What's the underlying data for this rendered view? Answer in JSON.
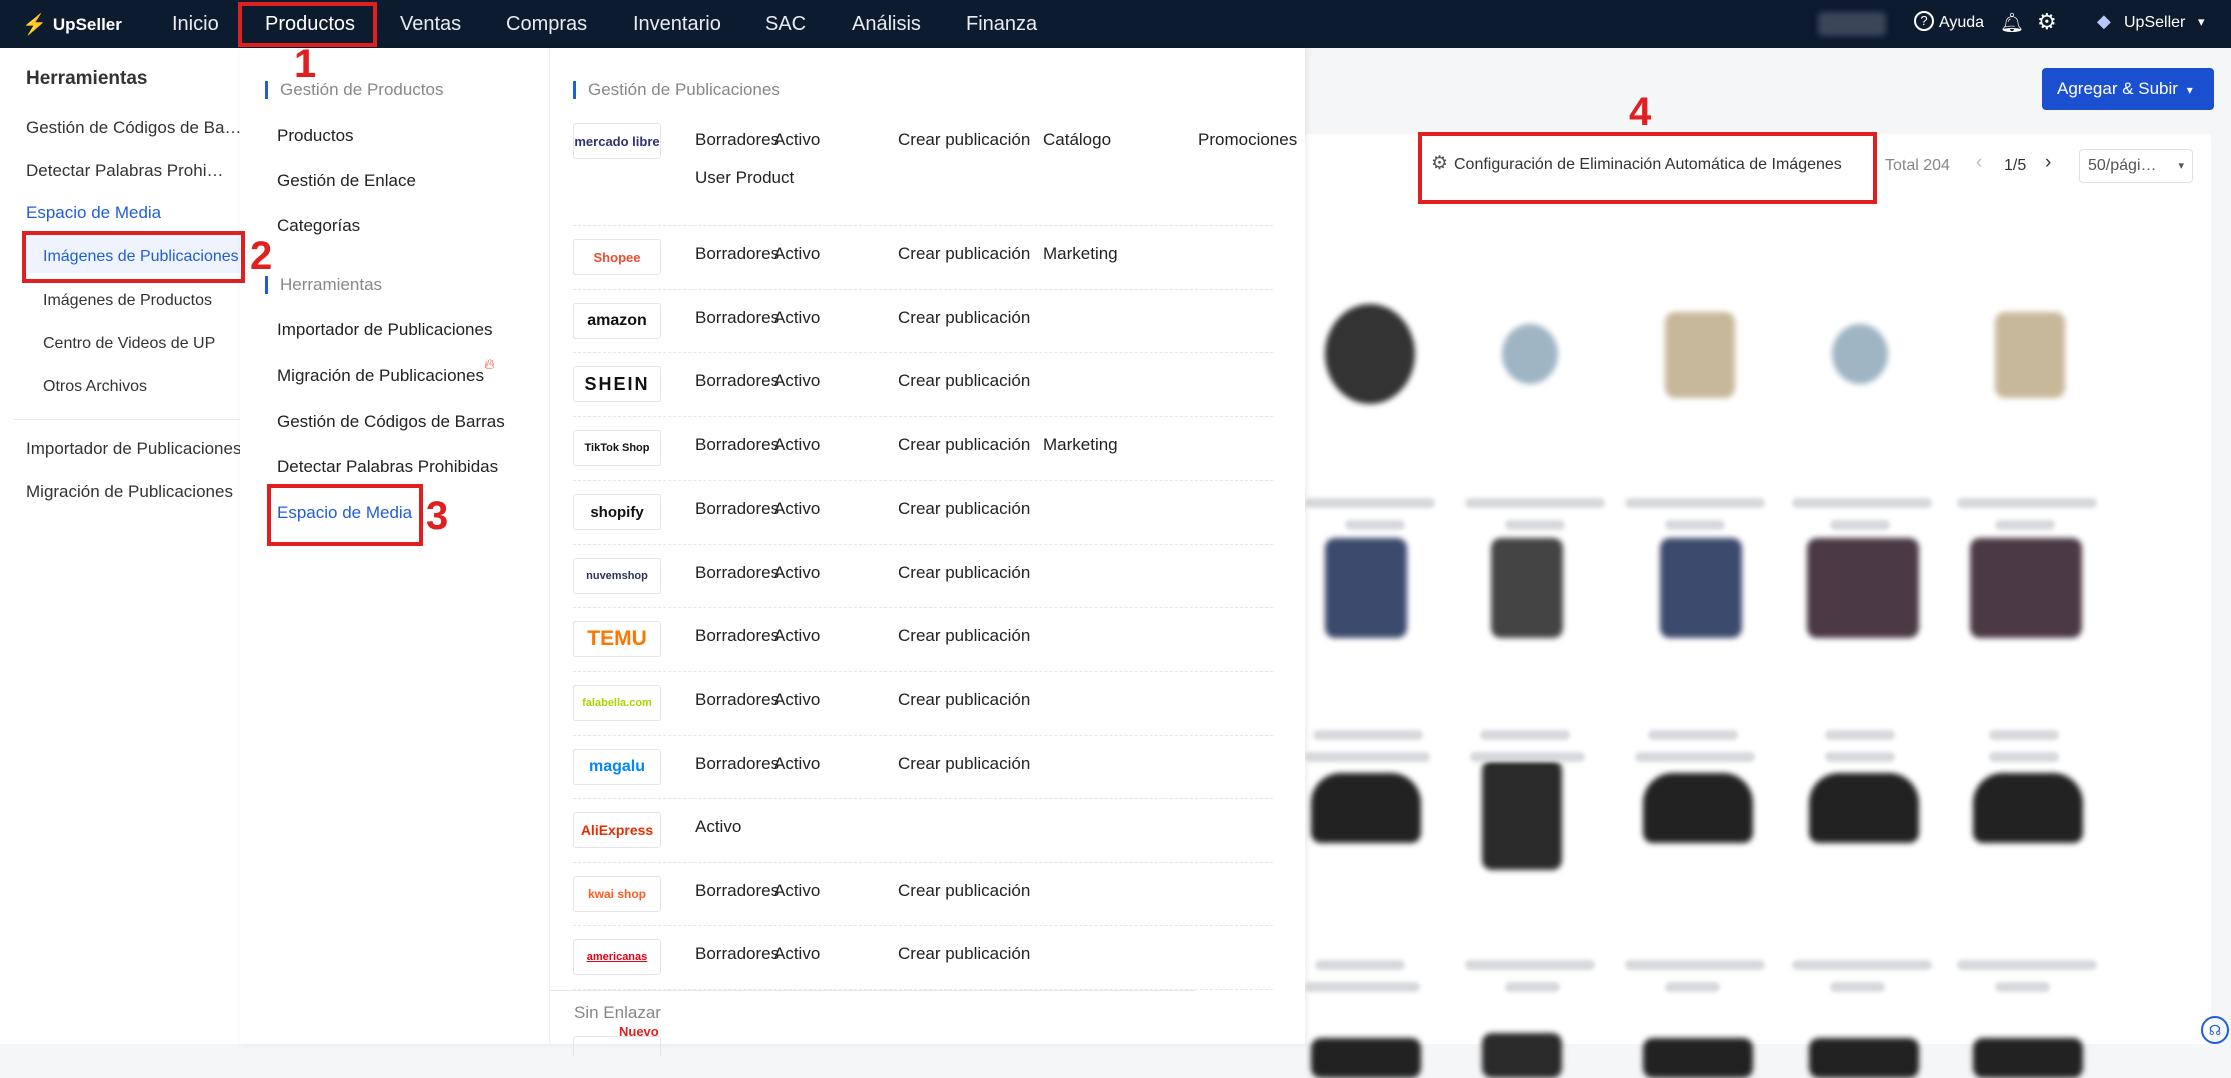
{
  "topnav": {
    "brand": "UpSeller",
    "items": [
      "Inicio",
      "Productos",
      "Ventas",
      "Compras",
      "Inventario",
      "SAC",
      "Análisis",
      "Finanza"
    ],
    "help": "Ayuda",
    "account": "UpSeller"
  },
  "sidebar": {
    "title": "Herramientas",
    "items": [
      "Gestión de Códigos de Ba…",
      "Detectar Palabras Prohi…",
      "Espacio de Media",
      "Imágenes de Publicaciones",
      "Imágenes de Productos",
      "Centro de Videos de UP",
      "Otros Archivos",
      "Importador de Publicaciones",
      "Migración de Publicaciones"
    ]
  },
  "mega": {
    "sec1": "Gestión de Productos",
    "sec1_items": [
      "Productos",
      "Gestión de Enlace",
      "Categorías"
    ],
    "sec2": "Herramientas",
    "sec2_items": [
      "Importador de Publicaciones",
      "Migración de Publicaciones",
      "Gestión de Códigos de Barras",
      "Detectar Palabras Prohibidas",
      "Espacio de Media"
    ],
    "sec3": "Gestión de Publicaciones",
    "unlinked": "Sin Enlazar",
    "new_badge": "Nuevo"
  },
  "platforms": [
    {
      "logo": "mercado libre",
      "actions": [
        "Borradores",
        "Activo",
        "Crear publicación",
        "Catálogo",
        "Promociones",
        "User Product"
      ]
    },
    {
      "logo": "Shopee",
      "actions": [
        "Borradores",
        "Activo",
        "Crear publicación",
        "Marketing"
      ]
    },
    {
      "logo": "amazon",
      "actions": [
        "Borradores",
        "Activo",
        "Crear publicación"
      ]
    },
    {
      "logo": "SHEIN",
      "actions": [
        "Borradores",
        "Activo",
        "Crear publicación"
      ]
    },
    {
      "logo": "TikTok Shop",
      "actions": [
        "Borradores",
        "Activo",
        "Crear publicación",
        "Marketing"
      ]
    },
    {
      "logo": "shopify",
      "actions": [
        "Borradores",
        "Activo",
        "Crear publicación"
      ]
    },
    {
      "logo": "nuvemshop",
      "actions": [
        "Borradores",
        "Activo",
        "Crear publicación"
      ]
    },
    {
      "logo": "TEMU",
      "actions": [
        "Borradores",
        "Activo",
        "Crear publicación"
      ]
    },
    {
      "logo": "falabella.com",
      "actions": [
        "Borradores",
        "Activo",
        "Crear publicación"
      ]
    },
    {
      "logo": "magalu",
      "actions": [
        "Borradores",
        "Activo",
        "Crear publicación"
      ]
    },
    {
      "logo": "AliExpress",
      "actions": [
        "Activo"
      ]
    },
    {
      "logo": "kwai shop",
      "actions": [
        "Borradores",
        "Activo",
        "Crear publicación"
      ]
    },
    {
      "logo": "americanas",
      "actions": [
        "Borradores",
        "Activo",
        "Crear publicación"
      ]
    }
  ],
  "content": {
    "upload_button": "Agregar & Subir",
    "config": "Configuración de Eliminación Automática de Imágenes",
    "total": "Total 204",
    "pager": "1/5",
    "per_page": "50/pági…"
  },
  "annotations": [
    "1",
    "2",
    "3",
    "4"
  ],
  "colors": {
    "nav_bg": "#0d1b2e",
    "accent": "#1f5fd6",
    "annotation": "#e02020"
  }
}
